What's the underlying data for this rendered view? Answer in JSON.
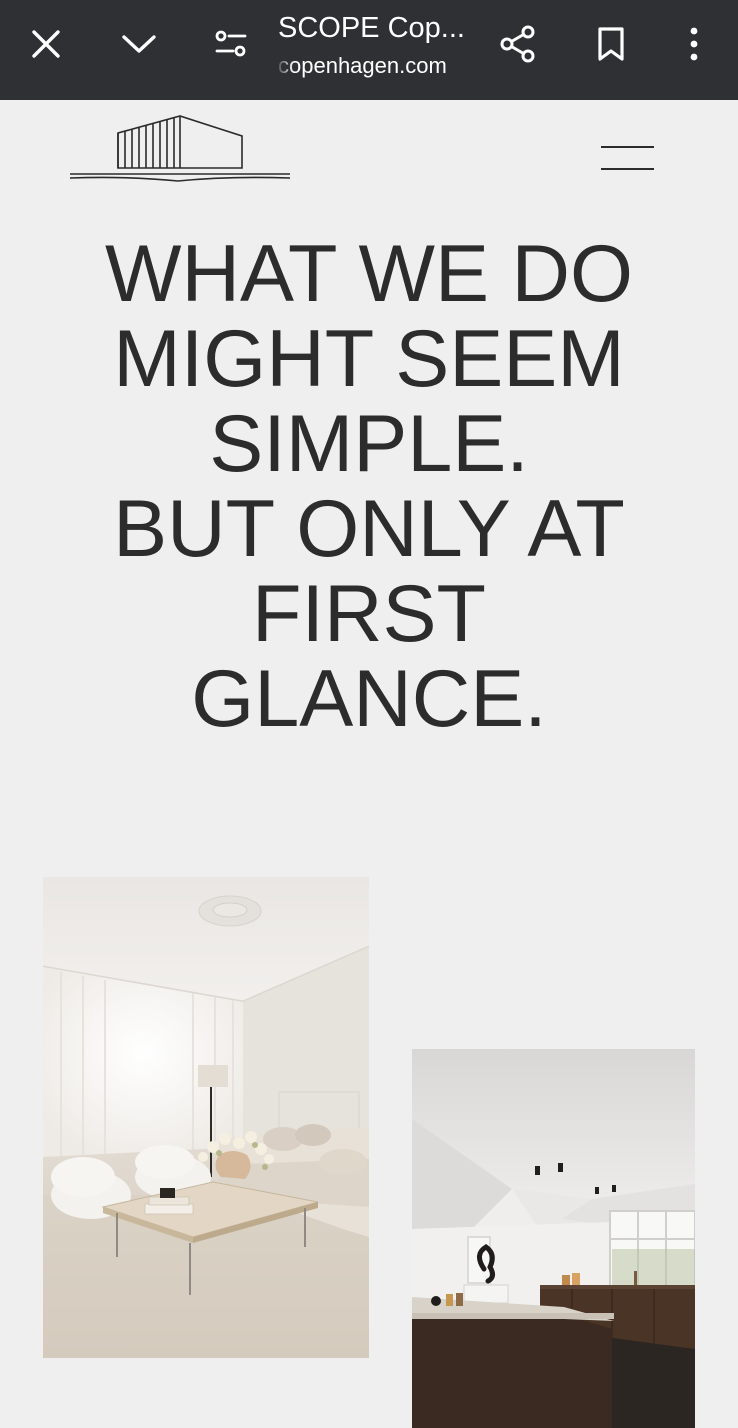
{
  "browser": {
    "page_title": "SCOPE Cop...",
    "url_text": "copenhagen.com",
    "close_icon": "close-icon",
    "chevron_icon": "chevron-down-icon",
    "site_settings_icon": "tune-icon",
    "share_icon": "share-icon",
    "bookmark_icon": "bookmark-icon",
    "more_icon": "more-vert-icon",
    "toolbar_color": "#2f3033"
  },
  "site": {
    "logo_icon": "building-logo",
    "menu_icon": "hamburger-menu-icon"
  },
  "hero": {
    "lines": [
      "WHAT WE DO",
      "MIGHT SEEM",
      "SIMPLE.",
      "BUT ONLY AT",
      "FIRST",
      "GLANCE."
    ],
    "text_color": "#2c2c2c",
    "background": "#f0efef"
  },
  "gallery": {
    "images": [
      {
        "subject": "bright-living-room-photo"
      },
      {
        "subject": "attic-kitchen-photo"
      }
    ]
  }
}
